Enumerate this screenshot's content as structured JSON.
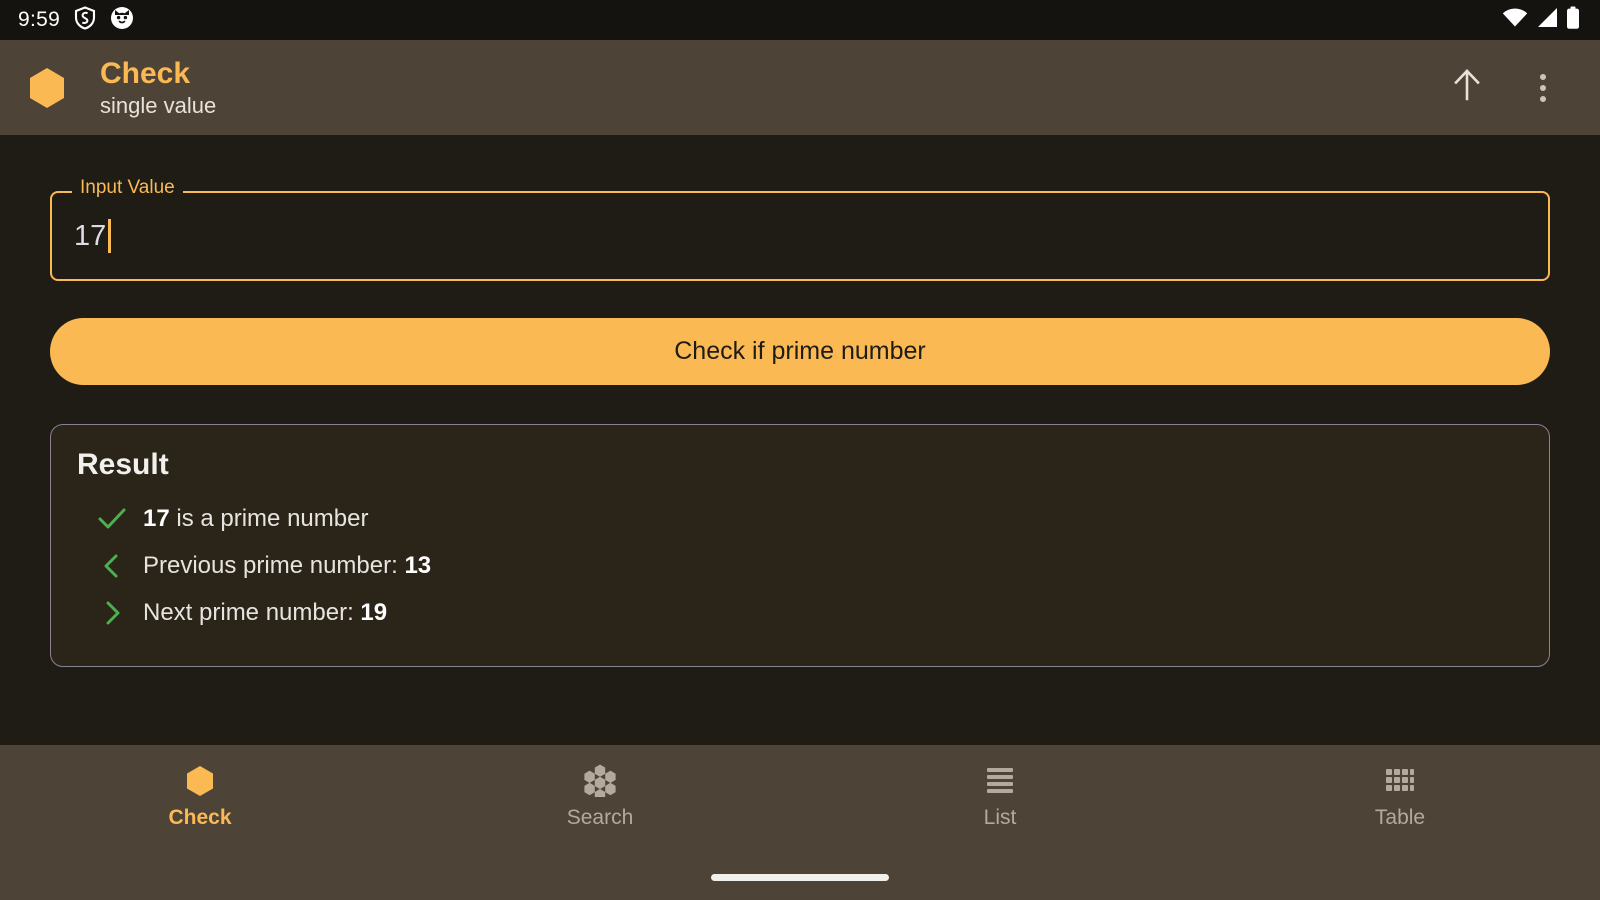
{
  "colors": {
    "accent": "#fbb954",
    "app_bar_bg": "#4e4337",
    "body_bg": "#1f1c16",
    "card_bg": "#2b2419",
    "status_bar_bg": "#15130f",
    "success_green": "#4caf50",
    "nav_inactive": "#b3a99c"
  },
  "status_bar": {
    "time": "9:59",
    "left_icons": [
      "shield-icon",
      "cat-face-icon"
    ],
    "right_icons": [
      "wifi-icon",
      "cellular-signal-icon",
      "battery-icon"
    ]
  },
  "app_bar": {
    "logo_icon": "hexagon-logo-icon",
    "title": "Check",
    "subtitle": "single value",
    "actions": [
      {
        "name": "upload-button",
        "icon": "arrow-up-icon"
      },
      {
        "name": "overflow-menu-button",
        "icon": "more-vertical-icon"
      }
    ]
  },
  "input_field": {
    "label": "Input Value",
    "value": "17",
    "placeholder": "Input Value"
  },
  "primary_button": {
    "label": "Check if prime number"
  },
  "result": {
    "title": "Result",
    "rows": [
      {
        "icon": "check-icon",
        "value": "17",
        "text": " is a prime number",
        "bold_first": true
      },
      {
        "icon": "chevron-left-icon",
        "text": "Previous prime number: ",
        "value": "13",
        "bold_first": false
      },
      {
        "icon": "chevron-right-icon",
        "text": "Next prime number: ",
        "value": "19",
        "bold_first": false
      }
    ]
  },
  "bottom_nav": {
    "items": [
      {
        "label": "Check",
        "icon": "hexagon-icon",
        "active": true
      },
      {
        "label": "Search",
        "icon": "honeycomb-icon",
        "active": false
      },
      {
        "label": "List",
        "icon": "list-lines-icon",
        "active": false
      },
      {
        "label": "Table",
        "icon": "table-grid-icon",
        "active": false
      }
    ]
  }
}
